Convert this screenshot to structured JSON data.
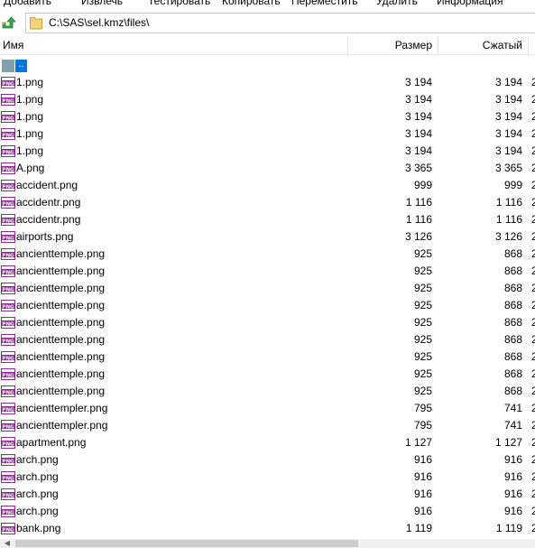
{
  "toolbar": {
    "items": [
      "Добавить",
      "Извлечь",
      "Тестировать",
      "Копировать",
      "Переместить",
      "Удалить",
      "Информация"
    ]
  },
  "address": {
    "path": "C:\\SAS\\sel.kmz\\files\\"
  },
  "columns": {
    "name": "Имя",
    "size": "Размер",
    "packed": "Сжатый"
  },
  "parent": {
    "label": ".."
  },
  "icon_text": "PNG",
  "files": [
    {
      "name": "1.png",
      "size": "3 194",
      "packed": "3 194",
      "extra": "2"
    },
    {
      "name": "1.png",
      "size": "3 194",
      "packed": "3 194",
      "extra": "2"
    },
    {
      "name": "1.png",
      "size": "3 194",
      "packed": "3 194",
      "extra": "2"
    },
    {
      "name": "1.png",
      "size": "3 194",
      "packed": "3 194",
      "extra": "2"
    },
    {
      "name": "1.png",
      "size": "3 194",
      "packed": "3 194",
      "extra": "2"
    },
    {
      "name": "A.png",
      "size": "3 365",
      "packed": "3 365",
      "extra": "2"
    },
    {
      "name": "accident.png",
      "size": "999",
      "packed": "999",
      "extra": "2"
    },
    {
      "name": "accidentr.png",
      "size": "1 116",
      "packed": "1 116",
      "extra": "2"
    },
    {
      "name": "accidentr.png",
      "size": "1 116",
      "packed": "1 116",
      "extra": "2"
    },
    {
      "name": "airports.png",
      "size": "3 126",
      "packed": "3 126",
      "extra": "2"
    },
    {
      "name": "ancienttemple.png",
      "size": "925",
      "packed": "868",
      "extra": "2"
    },
    {
      "name": "ancienttemple.png",
      "size": "925",
      "packed": "868",
      "extra": "2"
    },
    {
      "name": "ancienttemple.png",
      "size": "925",
      "packed": "868",
      "extra": "2"
    },
    {
      "name": "ancienttemple.png",
      "size": "925",
      "packed": "868",
      "extra": "2"
    },
    {
      "name": "ancienttemple.png",
      "size": "925",
      "packed": "868",
      "extra": "2"
    },
    {
      "name": "ancienttemple.png",
      "size": "925",
      "packed": "868",
      "extra": "2"
    },
    {
      "name": "ancienttemple.png",
      "size": "925",
      "packed": "868",
      "extra": "2"
    },
    {
      "name": "ancienttemple.png",
      "size": "925",
      "packed": "868",
      "extra": "2"
    },
    {
      "name": "ancienttemple.png",
      "size": "925",
      "packed": "868",
      "extra": "2"
    },
    {
      "name": "ancienttempler.png",
      "size": "795",
      "packed": "741",
      "extra": "2"
    },
    {
      "name": "ancienttempler.png",
      "size": "795",
      "packed": "741",
      "extra": "2"
    },
    {
      "name": "apartment.png",
      "size": "1 127",
      "packed": "1 127",
      "extra": "2"
    },
    {
      "name": "arch.png",
      "size": "916",
      "packed": "916",
      "extra": "2"
    },
    {
      "name": "arch.png",
      "size": "916",
      "packed": "916",
      "extra": "2"
    },
    {
      "name": "arch.png",
      "size": "916",
      "packed": "916",
      "extra": "2"
    },
    {
      "name": "arch.png",
      "size": "916",
      "packed": "916",
      "extra": "2"
    },
    {
      "name": "bank.png",
      "size": "1 119",
      "packed": "1 119",
      "extra": "2"
    }
  ],
  "colors": {
    "selection": "#0078d7",
    "png_icon": "#8b2d8e",
    "up_arrow": "#3aa845",
    "folder": "#e8b847"
  }
}
